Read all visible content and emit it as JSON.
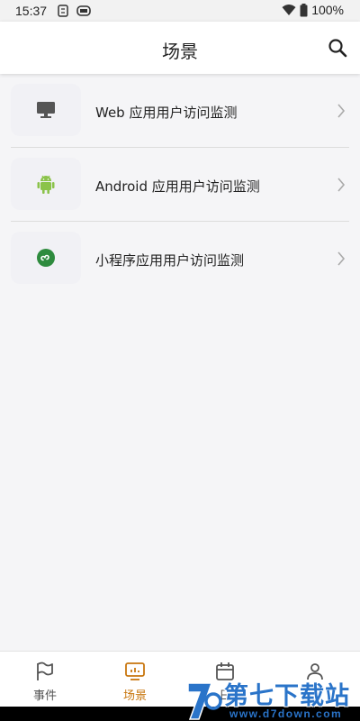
{
  "status_bar": {
    "time": "15:37",
    "battery": "100%",
    "icons": [
      "sync-icon",
      "cloud-icon",
      "wifi-icon",
      "battery-icon"
    ]
  },
  "header": {
    "title": "场景",
    "search_icon": "search-icon"
  },
  "scenarios": [
    {
      "label": "Web 应用用户访问监测",
      "icon": "monitor-icon",
      "icon_color": "#555555"
    },
    {
      "label": "Android 应用用户访问监测",
      "icon": "android-icon",
      "icon_color": "#8bc34a"
    },
    {
      "label": "小程序应用用户访问监测",
      "icon": "mini-program-icon",
      "icon_color": "#2e8b3e"
    }
  ],
  "tabbar": {
    "tabs": [
      {
        "label": "事件",
        "icon": "flag-icon",
        "active": false
      },
      {
        "label": "场景",
        "icon": "dashboard-icon",
        "active": true
      },
      {
        "label": "日",
        "icon": "calendar-icon",
        "active": false
      },
      {
        "label": "",
        "icon": "person-icon",
        "active": false
      }
    ],
    "active_color": "#c8760e"
  },
  "watermark": {
    "text": "第七下载站",
    "url": "www.d7down.com"
  }
}
